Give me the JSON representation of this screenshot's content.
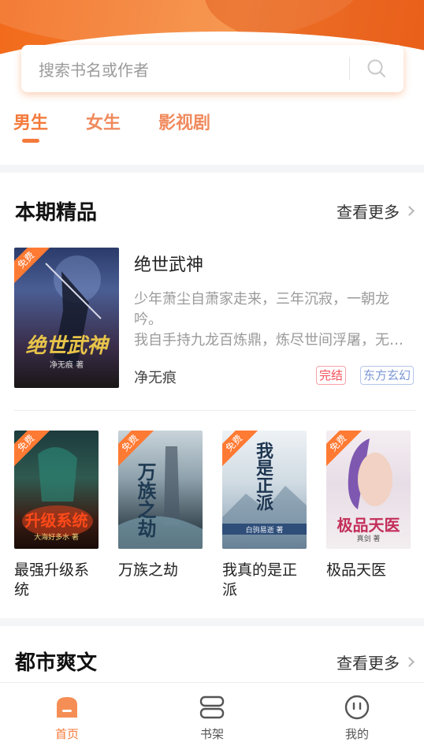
{
  "search": {
    "placeholder": "搜索书名或作者",
    "icon": "search-icon"
  },
  "tabs": [
    {
      "label": "男生",
      "active": true
    },
    {
      "label": "女生",
      "active": false
    },
    {
      "label": "影视剧",
      "active": false
    }
  ],
  "section1": {
    "title": "本期精品",
    "more": "查看更多",
    "featured": {
      "badge": "免费",
      "cover_text": "绝世武神",
      "cover_author": "净无痕 著",
      "title": "绝世武神",
      "desc_line1": "少年萧尘自萧家走来，三年沉寂，一朝龙",
      "desc_line2": "吟。",
      "desc_line3": "我自手持九龙百炼鼎，炼尽世间浮屠，无敌于世",
      "author": "净无痕",
      "tag_status": "完结",
      "tag_genre": "东方玄幻"
    },
    "books": [
      {
        "badge": "免费",
        "cover_text": "升级系统",
        "cover_author": "大海好多水 著",
        "title": "最强升级系统"
      },
      {
        "badge": "免费",
        "cover_text": "万族之劫",
        "cover_author": "",
        "title": "万族之劫"
      },
      {
        "badge": "免费",
        "cover_text": "我是正派",
        "cover_author": "白驹易逝 著",
        "title": "我真的是正派"
      },
      {
        "badge": "免费",
        "cover_text": "极品天医",
        "cover_author": "真剑 著",
        "title": "极品天医"
      }
    ]
  },
  "section2": {
    "title": "都市爽文",
    "more": "查看更多"
  },
  "bottom_nav": [
    {
      "label": "首页",
      "icon": "home-icon",
      "active": true
    },
    {
      "label": "书架",
      "icon": "bookshelf-icon",
      "active": false
    },
    {
      "label": "我的",
      "icon": "profile-icon",
      "active": false
    }
  ],
  "colors": {
    "accent": "#f37a3b",
    "badge": "#ff7a33",
    "status_tag": "#f24f5a",
    "genre_tag": "#7c97d6"
  }
}
